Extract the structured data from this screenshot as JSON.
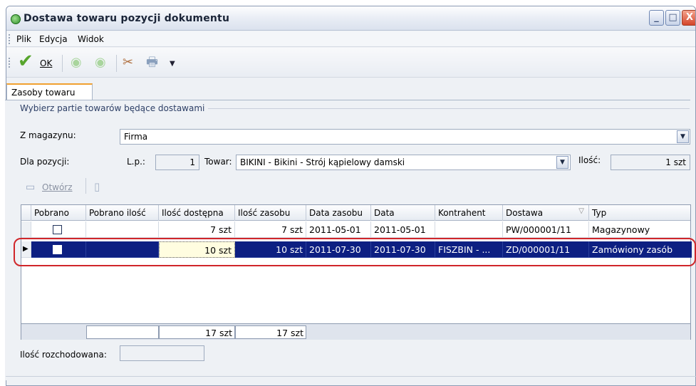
{
  "window": {
    "title": "Dostawa towaru pozycji dokumentu",
    "buttons": {
      "min": "_",
      "max": "□",
      "close": "X"
    }
  },
  "menu": {
    "items": [
      "Plik",
      "Edycja",
      "Widok"
    ]
  },
  "toolbar": {
    "ok_label": "OK"
  },
  "tab": {
    "label": "Zasoby towaru"
  },
  "form": {
    "section_title": "Wybierz partie towarów będące dostawami",
    "magazyn_label": "Z magazynu:",
    "magazyn_value": "Firma",
    "dla_pozycji_label": "Dla pozycji:",
    "lp_label": "L.p.:",
    "lp_value": "1",
    "towar_label": "Towar:",
    "towar_value": "BIKINI - Bikini - Strój kąpielowy damski",
    "ilosc_label": "Ilość:",
    "ilosc_value": "1 szt",
    "otworz_label": "Otwórz"
  },
  "grid": {
    "columns": [
      "Pobrano",
      "Pobrano ilość",
      "Ilość dostępna",
      "Ilość zasobu",
      "Data zasobu",
      "Data",
      "Kontrahent",
      "Dostawa",
      "Typ"
    ],
    "rows": [
      {
        "pobrano": false,
        "pobrano_ilosc": "",
        "ilosc_dostepna": "7 szt",
        "ilosc_zasobu": "7 szt",
        "data_zasobu": "2011-05-01",
        "data": "2011-05-01",
        "kontrahent": "",
        "dostawa": "PW/000001/11",
        "typ": "Magazynowy"
      },
      {
        "pobrano": false,
        "pobrano_ilosc": "",
        "ilosc_dostepna": "10 szt",
        "ilosc_zasobu": "10 szt",
        "data_zasobu": "2011-07-30",
        "data": "2011-07-30",
        "kontrahent": "FISZBIN - ...",
        "dostawa": "ZD/000001/11",
        "typ": "Zamówiony zasób"
      }
    ],
    "totals": {
      "ilosc_dostepna": "17 szt",
      "ilosc_zasobu": "17 szt"
    }
  },
  "bottom": {
    "rozchodowana_label": "Ilość rozchodowana:",
    "rozchodowana_value": ""
  }
}
